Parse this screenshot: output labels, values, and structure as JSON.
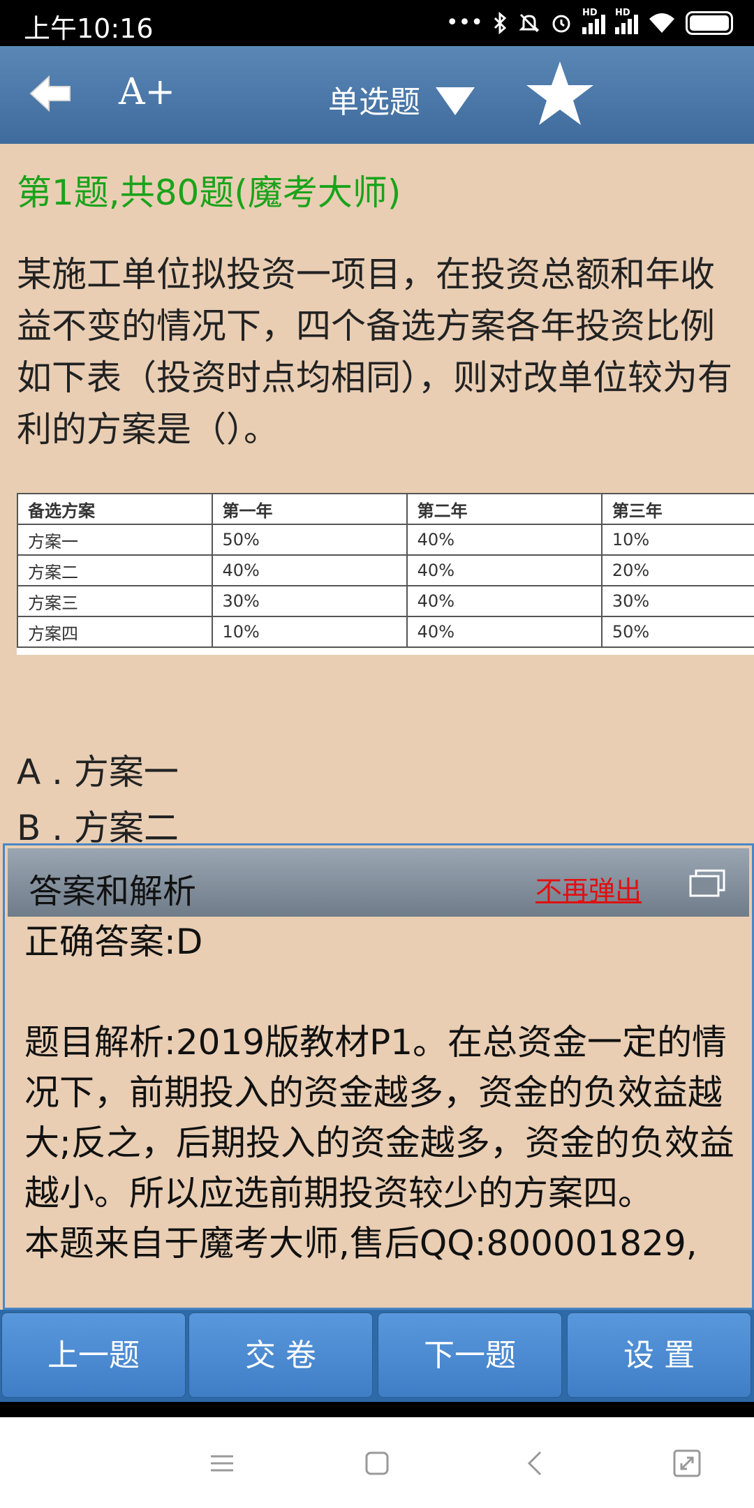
{
  "status_bar": {
    "time": "上午10:16",
    "icons": [
      "more-dots-icon",
      "bluetooth-icon",
      "mute-icon",
      "alarm-icon",
      "hd-signal-icon",
      "hd-signal-icon",
      "wifi-icon",
      "battery-icon"
    ],
    "hd_label": "HD"
  },
  "header": {
    "font_size_label": "A+",
    "title": "单选题",
    "icons": [
      "back-arrow-icon",
      "triangle-down-icon",
      "star-icon"
    ]
  },
  "question": {
    "meta": "第1题,共80题(魔考大师)",
    "text": "某施工单位拟投资一项目，在投资总额和年收益不变的情况下，四个备选方案各年投资比例如下表（投资时点均相同），则对改单位较为有利的方案是（）。",
    "table": {
      "headers": [
        "备选方案",
        "第一年",
        "第二年",
        "第三年"
      ],
      "rows": [
        [
          "方案一",
          "50%",
          "40%",
          "10%"
        ],
        [
          "方案二",
          "40%",
          "40%",
          "20%"
        ],
        [
          "方案三",
          "30%",
          "40%",
          "30%"
        ],
        [
          "方案四",
          "10%",
          "40%",
          "50%"
        ]
      ]
    },
    "options": [
      "A . 方案一",
      "B . 方案二"
    ]
  },
  "popup": {
    "title": "答案和解析",
    "no_popup_label": "不再弹出",
    "answer": "正确答案:D",
    "analysis": "题目解析:2019版教材P1。在总资金一定的情况下，前期投入的资金越多，资金的负效益越大;反之，后期投入的资金越多，资金的负效益越小。所以应选前期投资较少的方案四。",
    "source": "本题来自于魔考大师,售后QQ:800001829,"
  },
  "bottom_bar": {
    "prev_label": "上一题",
    "submit_label": "交 卷",
    "next_label": "下一题",
    "settings_label": "设 置"
  },
  "system_nav": {
    "icons": [
      "menu-icon",
      "home-icon",
      "back-icon",
      "screenshot-icon"
    ]
  },
  "colors": {
    "header_blue": "#4a77a8",
    "content_bg": "#e9ceb4",
    "meta_green": "#1aa31a",
    "link_red": "#e01010",
    "button_blue": "#4a8ad2"
  }
}
